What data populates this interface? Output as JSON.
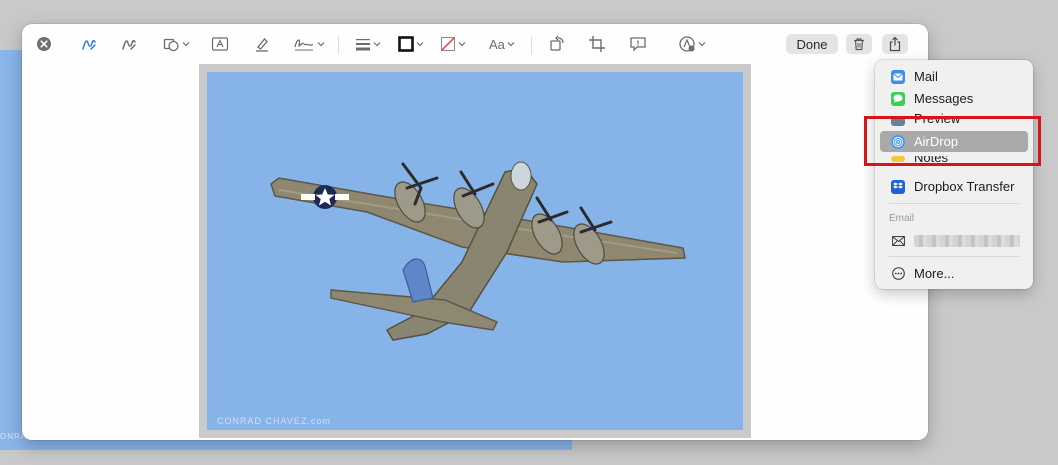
{
  "background": {
    "caption": "ONRA"
  },
  "toolbar": {
    "text_style_label": "Aa",
    "done_label": "Done"
  },
  "image": {
    "watermark": "CONRAD CHAVEZ.com",
    "sky_color": "#86b4e8"
  },
  "share_menu": {
    "items": [
      {
        "label": "Mail",
        "icon": "mail-icon"
      },
      {
        "label": "Messages",
        "icon": "messages-icon"
      },
      {
        "label": "Preview",
        "icon": "preview-icon"
      },
      {
        "label": "AirDrop",
        "icon": "airdrop-icon",
        "selected": true
      },
      {
        "label": "Notes",
        "icon": "notes-icon"
      },
      {
        "label": "Dropbox Transfer",
        "icon": "dropbox-icon"
      }
    ],
    "section_header": "Email",
    "more_label": "More..."
  },
  "colors": {
    "highlight": "#d7141a",
    "selected_item": "#a9a9a9",
    "markup_accent": "#2f7be0"
  }
}
